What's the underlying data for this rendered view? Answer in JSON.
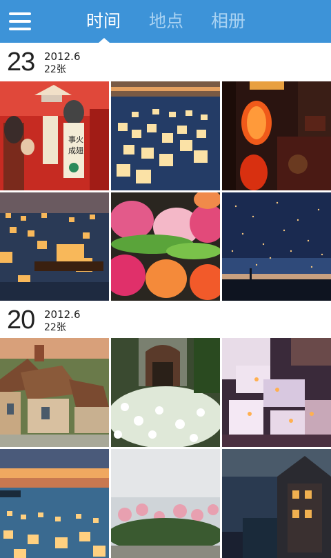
{
  "header": {
    "menu_icon": "hamburger-menu-icon",
    "tabs": [
      {
        "label": "时间",
        "active": true
      },
      {
        "label": "地点",
        "active": false
      },
      {
        "label": "相册",
        "active": false
      }
    ],
    "colors": {
      "bar": "#3d93d8",
      "active_tab": "#ffffff",
      "inactive_tab": "#a9d2f2"
    }
  },
  "sections": [
    {
      "day": "23",
      "month": "2012.6",
      "count": "22张",
      "photos": [
        "paper-lanterns-red",
        "floating-lanterns-water",
        "red-lantern-street",
        "floating-lanterns-boat",
        "lotus-lanterns",
        "sky-lanterns-night"
      ]
    },
    {
      "day": "20",
      "month": "2012.6",
      "count": "22张",
      "photos": [
        "cottage-row",
        "garden-white-flowers",
        "white-village-night",
        "lanterns-sunset-sea",
        "pink-blossoms",
        "house-night"
      ]
    }
  ]
}
